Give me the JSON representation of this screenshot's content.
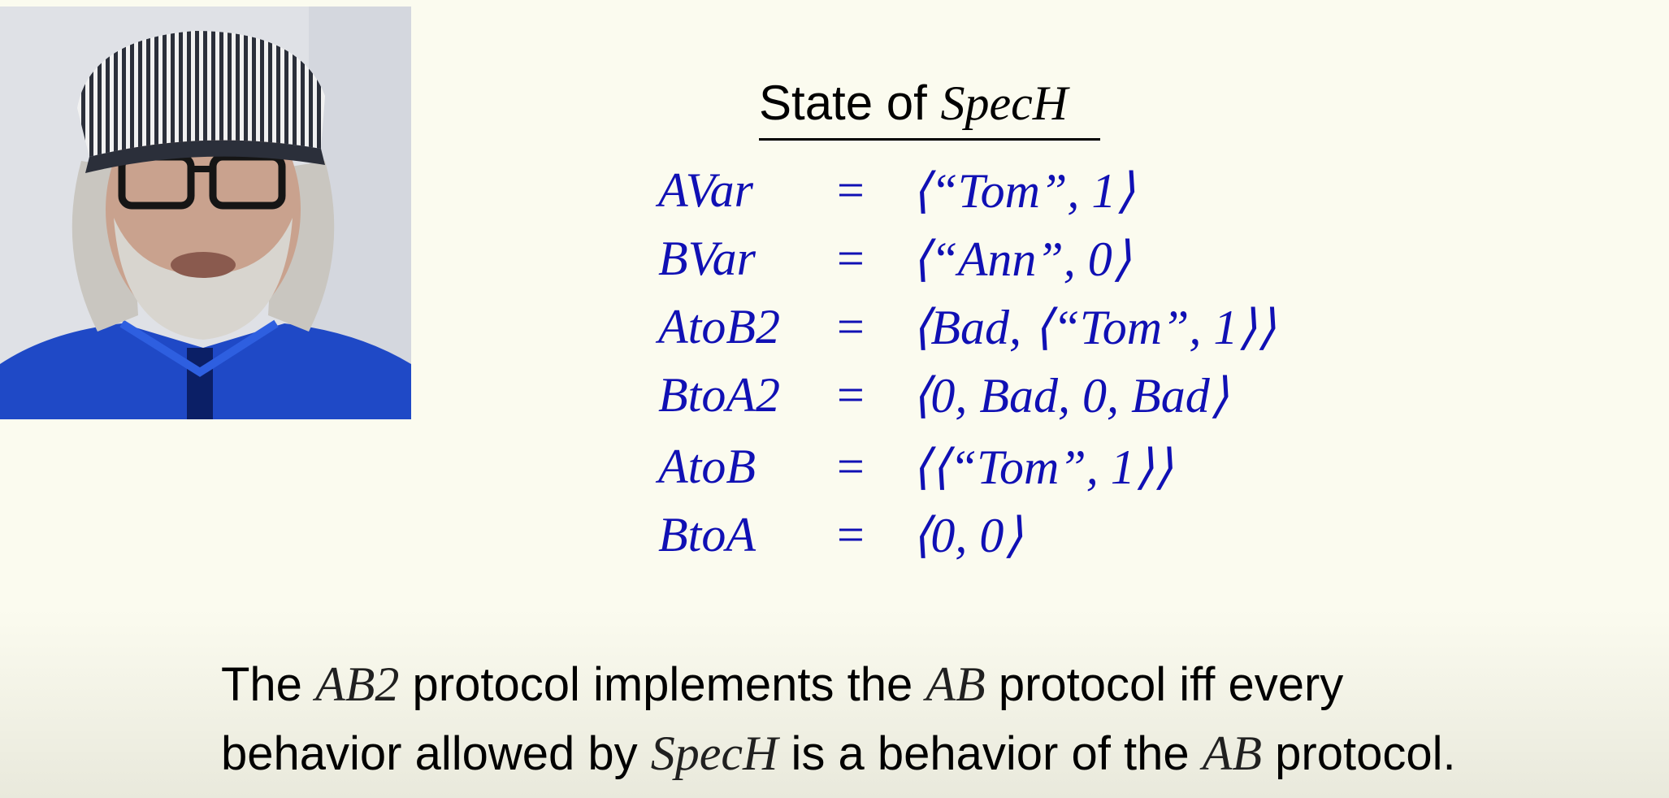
{
  "slide": {
    "title_prefix": "State of",
    "title_math": "SpecH"
  },
  "equations": [
    {
      "lhs": "AVar",
      "rhs": "⟨“Tom”, 1⟩"
    },
    {
      "lhs": "BVar",
      "rhs": "⟨“Ann”, 0⟩"
    },
    {
      "lhs": "AtoB2",
      "rhs": "⟨Bad, ⟨“Tom”, 1⟩⟩"
    },
    {
      "lhs": "BtoA2",
      "rhs": "⟨0, Bad, 0, Bad⟩"
    },
    {
      "lhs": "AtoB",
      "rhs": "⟨⟨“Tom”, 1⟩⟩"
    },
    {
      "lhs": "BtoA",
      "rhs": "⟨0, 0⟩"
    }
  ],
  "equals_sign": "=",
  "caption": {
    "l1_a": "The",
    "l1_m1": "AB2",
    "l1_b": "protocol implements the",
    "l1_m2": "AB",
    "l1_c": "protocol iff every",
    "l2_a": "behavior allowed by",
    "l2_m1": "SpecH",
    "l2_b": "is a behavior of the",
    "l2_m2": "AB",
    "l2_c": "protocol."
  },
  "colors": {
    "background": "#fbfbef",
    "math_blue": "#1010b4",
    "text": "#000000"
  }
}
